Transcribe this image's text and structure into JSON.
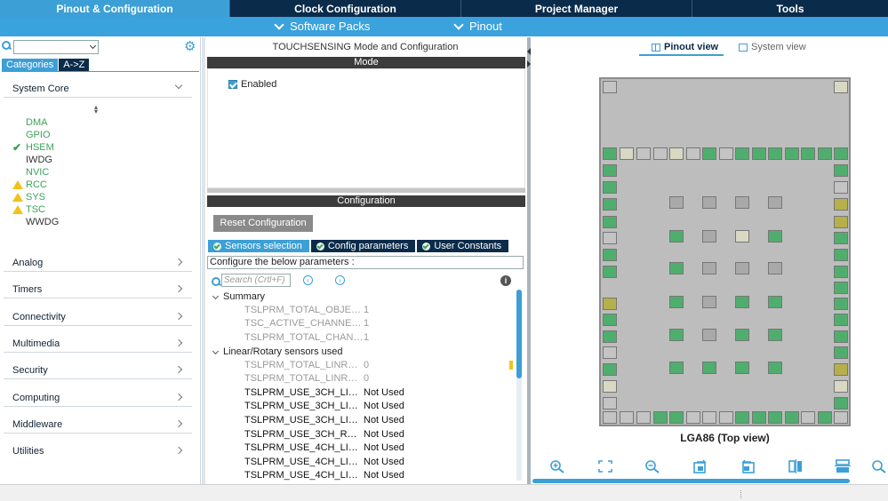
{
  "tabs": [
    {
      "label": "Pinout & Configuration"
    },
    {
      "label": "Clock Configuration"
    },
    {
      "label": "Project Manager"
    },
    {
      "label": "Tools"
    }
  ],
  "subbar": {
    "software_packs": "Software Packs",
    "pinout": "Pinout"
  },
  "left": {
    "categories_label": "Categories",
    "az_label": "A->Z",
    "system_core": "System Core",
    "peripherals": [
      {
        "name": "DMA",
        "status": "none",
        "color": "green"
      },
      {
        "name": "GPIO",
        "status": "none",
        "color": "green"
      },
      {
        "name": "HSEM",
        "status": "ok",
        "color": "green"
      },
      {
        "name": "IWDG",
        "status": "none",
        "color": "dark"
      },
      {
        "name": "NVIC",
        "status": "none",
        "color": "green"
      },
      {
        "name": "RCC",
        "status": "warning",
        "color": "green"
      },
      {
        "name": "SYS",
        "status": "warning",
        "color": "green"
      },
      {
        "name": "TSC",
        "status": "warning",
        "color": "green"
      },
      {
        "name": "WWDG",
        "status": "none",
        "color": "dark"
      }
    ],
    "groups": [
      "Analog",
      "Timers",
      "Connectivity",
      "Multimedia",
      "Security",
      "Computing",
      "Middleware",
      "Utilities"
    ]
  },
  "middle": {
    "title": "TOUCHSENSING Mode and Configuration",
    "mode_band": "Mode",
    "enabled_label": "Enabled",
    "config_band": "Configuration",
    "reset_button": "Reset Configuration",
    "cfg_tabs": [
      "Sensors selection",
      "Config parameters",
      "User Constants"
    ],
    "cfg_desc": "Configure the below parameters :",
    "search_placeholder": "Search (Crtl+F)",
    "summary_label": "Summary",
    "summary_params": [
      {
        "k": "TSLPRM_TOTAL_OBJECTS",
        "v": "1"
      },
      {
        "k": "TSC_ACTIVE_CHANNELS ...",
        "v": "1"
      },
      {
        "k": "TSLPRM_TOTAL_CHANNE...",
        "v": "1"
      }
    ],
    "linrot_label": "Linear/Rotary sensors used",
    "linrot_params": [
      {
        "k": "TSLPRM_TOTAL_LINROTS",
        "v": "0"
      },
      {
        "k": "TSLPRM_TOTAL_LINROTS...",
        "v": "0"
      }
    ],
    "used_params": [
      {
        "k": "TSLPRM_USE_3CH_LIN_M1",
        "v": "Not Used"
      },
      {
        "k": "TSLPRM_USE_3CH_LIN_M2",
        "v": "Not Used"
      },
      {
        "k": "TSLPRM_USE_3CH_LIN_H",
        "v": "Not Used"
      },
      {
        "k": "TSLPRM_USE_3CH_ROT_M",
        "v": "Not Used"
      },
      {
        "k": "TSLPRM_USE_4CH_LIN_M1",
        "v": "Not Used"
      },
      {
        "k": "TSLPRM_USE_4CH_LIN_M2",
        "v": "Not Used"
      },
      {
        "k": "TSLPRM_USE_4CH_LIN_H",
        "v": "Not Used"
      }
    ]
  },
  "right": {
    "pinout_view": "Pinout view",
    "system_view": "System view",
    "chip_title": "LGA86 (Top view)"
  }
}
